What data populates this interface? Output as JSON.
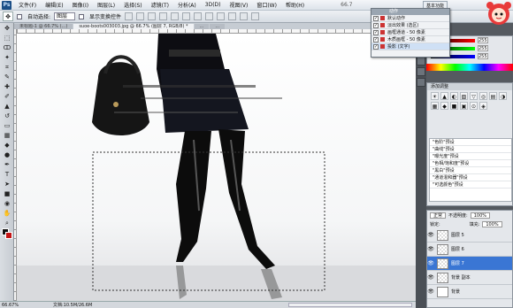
{
  "menu": {
    "logo": "Ps",
    "items": [
      "文件(F)",
      "编辑(E)",
      "图像(I)",
      "图层(L)",
      "选择(S)",
      "滤镜(T)",
      "分析(A)",
      "3D(D)",
      "视图(V)",
      "窗口(W)",
      "帮助(H)"
    ],
    "zoom": "66.7",
    "workspace": "基本功能"
  },
  "options": {
    "auto_select_label": "自动选择:",
    "auto_select_value": "图层",
    "show_transform_label": "显示变换控件"
  },
  "tabs": [
    {
      "label": "未标题-1 @ 66.7% (...)",
      "active": false
    },
    {
      "label": "suoe-boots003003.jpg @ 66.7% (图层 7, RGB/8) *",
      "active": true
    },
    {
      "label": "...",
      "active": false
    },
    {
      "label": "...",
      "active": false
    }
  ],
  "actions_panel": {
    "title": "动作",
    "items": [
      {
        "label": "默认动作",
        "active": false
      },
      {
        "label": "淡出效果 (选区)",
        "active": false
      },
      {
        "label": "画框通道 - 50 像素",
        "active": false
      },
      {
        "label": "木质画框 - 50 像素",
        "active": false
      },
      {
        "label": "投影 (文字)",
        "active": true
      }
    ]
  },
  "color_panel": {
    "values": [
      "255",
      "255",
      "255"
    ]
  },
  "adjustments_panel": {
    "title": "添加调整",
    "icons": [
      "☀",
      "▲",
      "◐",
      "▧",
      "▽",
      "◎",
      "▤",
      "◑",
      "▦",
      "◆",
      "■",
      "▣",
      "⊙",
      "◈"
    ],
    "presets": [
      "\"色阶\"预设",
      "\"曲线\"预设",
      "\"曝光度\"预设",
      "\"色相/饱和度\"预设",
      "\"黑白\"预设",
      "\"通道混和器\"预设",
      "\"可选颜色\"预设"
    ]
  },
  "layers_panel": {
    "blend": "正常",
    "opacity_label": "不透明度:",
    "opacity": "100%",
    "lock_label": "锁定:",
    "fill_label": "填充:",
    "fill": "100%",
    "layers": [
      {
        "name": "图层 5",
        "selected": false
      },
      {
        "name": "图层 6",
        "selected": false
      },
      {
        "name": "图层 7",
        "selected": true
      },
      {
        "name": "背景 副本",
        "selected": false
      },
      {
        "name": "背景",
        "selected": false
      }
    ]
  },
  "status": {
    "zoom": "66.67%",
    "doc": "文档:10.5M/26.6M"
  }
}
